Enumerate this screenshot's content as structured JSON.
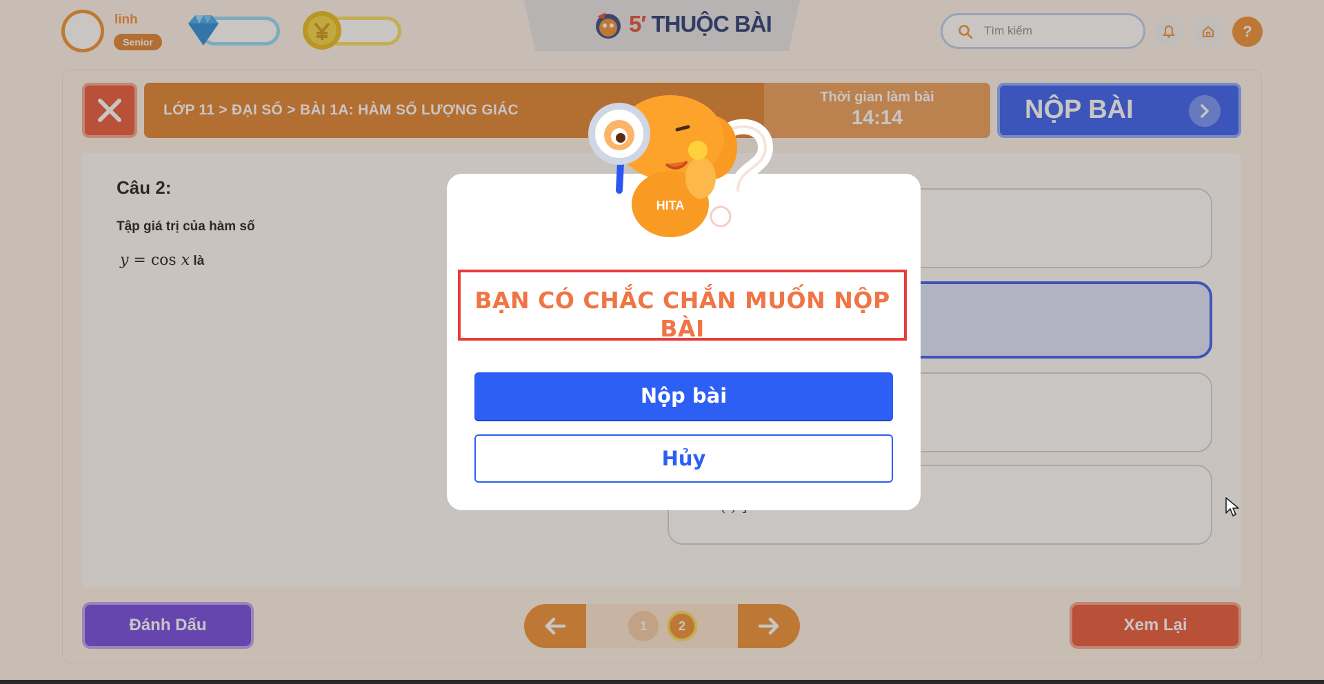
{
  "user": {
    "name": "linh",
    "rank": "Senior"
  },
  "logo": {
    "number": "5",
    "text": "THUỘC BÀI"
  },
  "search": {
    "placeholder": "Tìm kiếm"
  },
  "header": {
    "help_label": "?"
  },
  "quiz": {
    "breadcrumb": "LỚP 11 > ĐẠI SỐ > BÀI 1A: HÀM SỐ LƯỢNG GIÁC",
    "timer_label": "Thời gian làm bài",
    "timer_value": "14:14",
    "submit_label": "NỘP BÀI",
    "question_title": "Câu 2:",
    "question_text": "Tập giá trị của hàm số",
    "formula_y": "y",
    "formula_eq": " = cos ",
    "formula_x": "x",
    "formula_suffix": " là",
    "option_d_fragment": "( ) ]",
    "selected_option": 2
  },
  "footer": {
    "mark_label": "Đánh Dấu",
    "pages": [
      "1",
      "2"
    ],
    "current_page": 2,
    "review_label": "Xem Lại"
  },
  "dialog": {
    "title": "BẠN CÓ CHẮC CHẮN MUỐN NỘP BÀI",
    "mascot_text": "HITA",
    "submit_label": "Nộp bài",
    "cancel_label": "Hủy"
  },
  "colors": {
    "brand_orange": "#f08a2a",
    "primary_blue": "#2b56f2",
    "danger_red": "#e8502d",
    "mark_purple": "#6a3fe0"
  }
}
